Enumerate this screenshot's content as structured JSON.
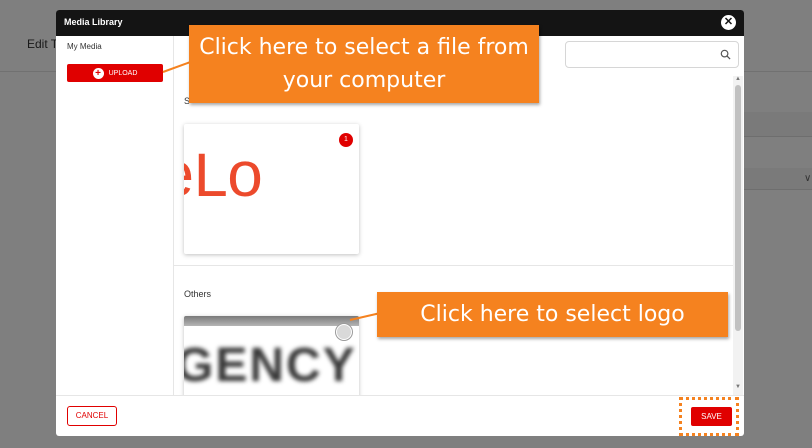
{
  "background": {
    "page_title": "Edit T"
  },
  "modal": {
    "title": "Media Library",
    "close_icon": "close-icon",
    "sidebar": {
      "heading": "My Media",
      "upload_label": "UPLOAD"
    },
    "search": {
      "placeholder": "",
      "value": ""
    },
    "sections": [
      {
        "label": "S",
        "items": [
          {
            "thumbnail_text": "eLo",
            "badge": "1"
          }
        ]
      },
      {
        "label": "Others",
        "items": [
          {
            "thumbnail_text": "GENCY",
            "selected": false
          }
        ]
      }
    ],
    "footer": {
      "cancel_label": "CANCEL",
      "save_label": "SAVE"
    }
  },
  "callouts": {
    "upload": "Click here to select a file from your computer",
    "logo": "Click here to select logo"
  },
  "colors": {
    "accent_red": "#e00000",
    "callout_orange": "#f5821f",
    "header_dark": "#141414",
    "logo_red": "#ec4a2c"
  }
}
